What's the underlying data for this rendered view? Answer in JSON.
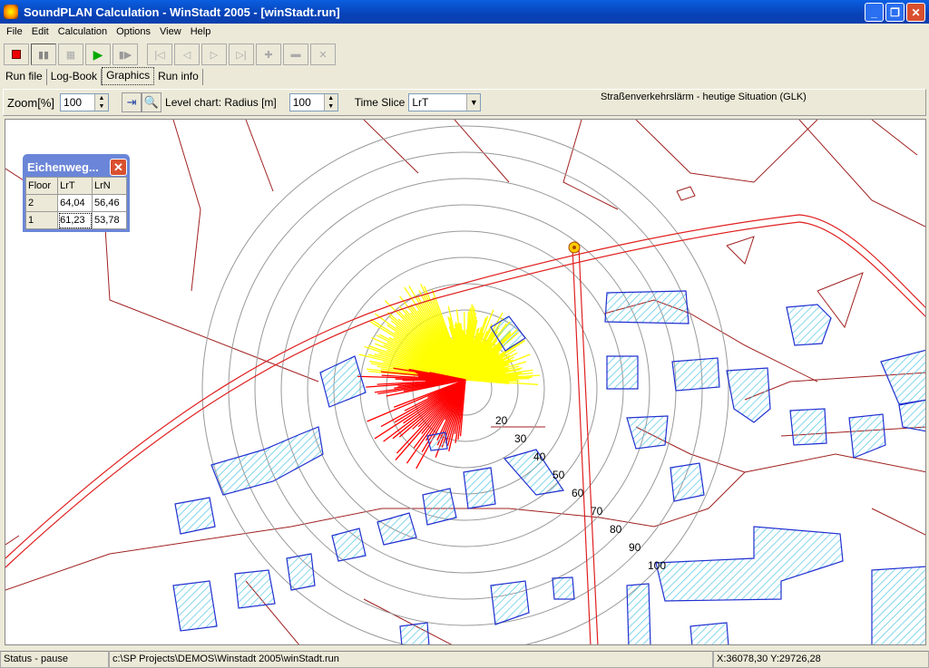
{
  "window": {
    "title": "SoundPLAN Calculation - WinStadt 2005 - [winStadt.run]"
  },
  "menu": [
    "File",
    "Edit",
    "Calculation",
    "Options",
    "View",
    "Help"
  ],
  "toolbar": {
    "icons": [
      "stop-icon",
      "pause-icon",
      "calc-icon",
      "play-icon",
      "step-icon",
      "first-icon",
      "prev-icon",
      "next-icon",
      "last-icon",
      "add-icon",
      "remove-icon",
      "cancel-icon"
    ]
  },
  "tabs": [
    {
      "label": "Run file"
    },
    {
      "label": "Log-Book"
    },
    {
      "label": "Graphics",
      "active": true
    },
    {
      "label": "Run info"
    }
  ],
  "options": {
    "zoom_label": "Zoom[%]",
    "zoom_value": "100",
    "level_chart_label": "Level chart: Radius [m]",
    "radius_value": "100",
    "time_slice_label": "Time Slice",
    "time_slice_value": "LrT",
    "scenario": "Straßenverkehrslärm  - heutige Situation (GLK)"
  },
  "popup": {
    "title": "Eichenweg...",
    "headers": [
      "Floor",
      "LrT",
      "LrN"
    ],
    "rows": [
      [
        "2",
        "64,04",
        "56,46"
      ],
      [
        "1",
        "61,23",
        "53,78"
      ]
    ]
  },
  "map": {
    "ring_labels": [
      "20",
      "30",
      "40",
      "50",
      "60",
      "70",
      "80",
      "90",
      "100"
    ],
    "colors": {
      "road": "#e02020",
      "parcel": "#a02020",
      "building": "#2030d0",
      "ring": "#999999",
      "ray_day": "#ffff00",
      "ray_night": "#ff0000"
    }
  },
  "status": {
    "state": "Status - pause",
    "file": "c:\\SP Projects\\DEMOS\\Winstadt 2005\\winStadt.run",
    "coords": "X:36078,30  Y:29726,28"
  }
}
